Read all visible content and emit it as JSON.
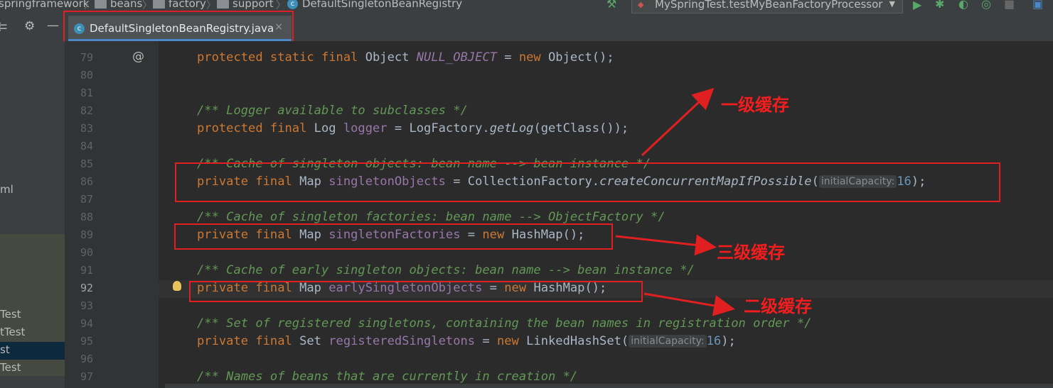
{
  "breadcrumbs": [
    "springframework",
    "beans",
    "factory",
    "support",
    "DefaultSingletonBeanRegistry"
  ],
  "run_config": "MySpringTest.testMyBeanFactoryProcessor",
  "active_tab": {
    "label": "DefaultSingletonBeanRegistry.java",
    "close": "×"
  },
  "project_items": [
    "ml",
    "Test",
    "tTest",
    "st",
    "Test"
  ],
  "gutter_marker": "@",
  "line_numbers": [
    "79",
    "80",
    "81",
    "82",
    "83",
    "84",
    "85",
    "86",
    "87",
    "88",
    "89",
    "90",
    "91",
    "92",
    "93",
    "94",
    "95",
    "96",
    "97"
  ],
  "current_line": "92",
  "code": {
    "l79": [
      "protected static final ",
      "Object ",
      "NULL_OBJECT",
      " = ",
      "new ",
      "Object();"
    ],
    "l82": "/** Logger available to subclasses */",
    "l83": [
      "protected final ",
      "Log ",
      "logger",
      " = LogFactory.",
      "getLog",
      "(getClass());"
    ],
    "l85": "/** Cache of singleton objects: bean name --> bean instance */",
    "l86": [
      "private final ",
      "Map ",
      "singletonObjects",
      " = CollectionFactory.",
      "createConcurrentMapIfPossible",
      "(",
      "initialCapacity:",
      "16",
      ");"
    ],
    "l88": "/** Cache of singleton factories: bean name --> ObjectFactory */",
    "l89": [
      "private final ",
      "Map ",
      "singletonFactories",
      " = ",
      "new ",
      "HashMap();"
    ],
    "l91": "/** Cache of early singleton objects: bean name --> bean instance */",
    "l92": [
      "private final ",
      "Map ",
      "earlySingletonObjects",
      " = ",
      "new ",
      "HashMap();"
    ],
    "l94": "/** Set of registered singletons, containing the bean names in registration order */",
    "l95": [
      "private final ",
      "Set ",
      "registeredSingletons",
      " = ",
      "new ",
      "LinkedHashSet(",
      "initialCapacity:",
      "16",
      ");"
    ],
    "l97": "/** Names of beans that are currently in creation */"
  },
  "annotations": {
    "first_level": "一级缓存",
    "third_level": "三级缓存",
    "second_level": "二级缓存"
  },
  "colors": {
    "annotation_red": "#e02020",
    "keyword": "#cc7832",
    "comment": "#629755",
    "field": "#9876aa",
    "number": "#6897bb"
  }
}
